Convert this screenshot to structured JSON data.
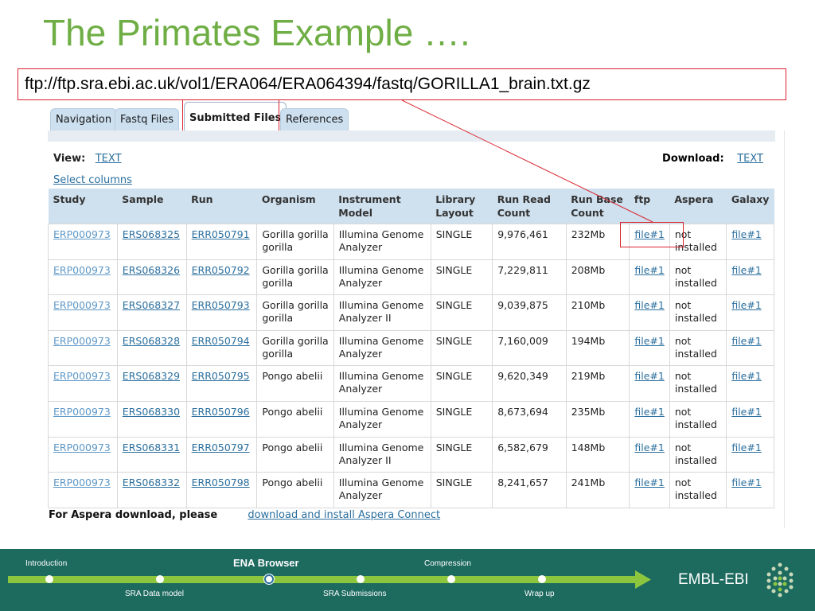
{
  "slide": {
    "title": "The Primates Example …."
  },
  "callout": {
    "url": "ftp://ftp.sra.ebi.ac.uk/vol1/ERA064/ERA064394/fastq/GORILLA1_brain.txt.gz"
  },
  "tabs": [
    {
      "label": "Navigation",
      "active": false
    },
    {
      "label": "Fastq Files",
      "active": false
    },
    {
      "label": "Submitted Files",
      "active": true
    },
    {
      "label": "References",
      "active": false
    }
  ],
  "view": {
    "label": "View:",
    "format": "TEXT"
  },
  "download": {
    "label": "Download:",
    "format": "TEXT"
  },
  "select_columns": "Select columns",
  "table": {
    "columns": [
      "Study",
      "Sample",
      "Run",
      "Organism",
      "Instrument Model",
      "Library Layout",
      "Run Read Count",
      "Run Base Count",
      "ftp",
      "Aspera",
      "Galaxy"
    ],
    "rows": [
      [
        "ERP000973",
        "ERS068325",
        "ERR050791",
        "Gorilla gorilla gorilla",
        "Illumina Genome Analyzer",
        "SINGLE",
        "9,976,461",
        "232Mb",
        "file#1",
        "not installed",
        "file#1"
      ],
      [
        "ERP000973",
        "ERS068326",
        "ERR050792",
        "Gorilla gorilla gorilla",
        "Illumina Genome Analyzer",
        "SINGLE",
        "7,229,811",
        "208Mb",
        "file#1",
        "not installed",
        "file#1"
      ],
      [
        "ERP000973",
        "ERS068327",
        "ERR050793",
        "Gorilla gorilla gorilla",
        "Illumina Genome Analyzer II",
        "SINGLE",
        "9,039,875",
        "210Mb",
        "file#1",
        "not installed",
        "file#1"
      ],
      [
        "ERP000973",
        "ERS068328",
        "ERR050794",
        "Gorilla gorilla gorilla",
        "Illumina Genome Analyzer",
        "SINGLE",
        "7,160,009",
        "194Mb",
        "file#1",
        "not installed",
        "file#1"
      ],
      [
        "ERP000973",
        "ERS068329",
        "ERR050795",
        "Pongo abelii",
        "Illumina Genome Analyzer",
        "SINGLE",
        "9,620,349",
        "219Mb",
        "file#1",
        "not installed",
        "file#1"
      ],
      [
        "ERP000973",
        "ERS068330",
        "ERR050796",
        "Pongo abelii",
        "Illumina Genome Analyzer",
        "SINGLE",
        "8,673,694",
        "235Mb",
        "file#1",
        "not installed",
        "file#1"
      ],
      [
        "ERP000973",
        "ERS068331",
        "ERR050797",
        "Pongo abelii",
        "Illumina Genome Analyzer II",
        "SINGLE",
        "6,582,679",
        "148Mb",
        "file#1",
        "not installed",
        "file#1"
      ],
      [
        "ERP000973",
        "ERS068332",
        "ERR050798",
        "Pongo abelii",
        "Illumina Genome Analyzer",
        "SINGLE",
        "8,241,657",
        "241Mb",
        "file#1",
        "not installed",
        "file#1"
      ]
    ]
  },
  "aspera": {
    "label": "For Aspera download, please",
    "link": "download and install Aspera Connect"
  },
  "footer": {
    "steps_top": [
      "Introduction",
      "ENA Browser",
      "Compression"
    ],
    "steps_bottom": [
      "SRA Data model",
      "SRA Submissions",
      "Wrap up"
    ],
    "current": "ENA Browser",
    "logo": "EMBL-EBI"
  },
  "colors": {
    "title_green": "#6fae45",
    "highlight_red": "#d9232e",
    "link_blue": "#2b6f9e",
    "footer_teal": "#1d6a5f",
    "arrow_green": "#8cc63e"
  }
}
